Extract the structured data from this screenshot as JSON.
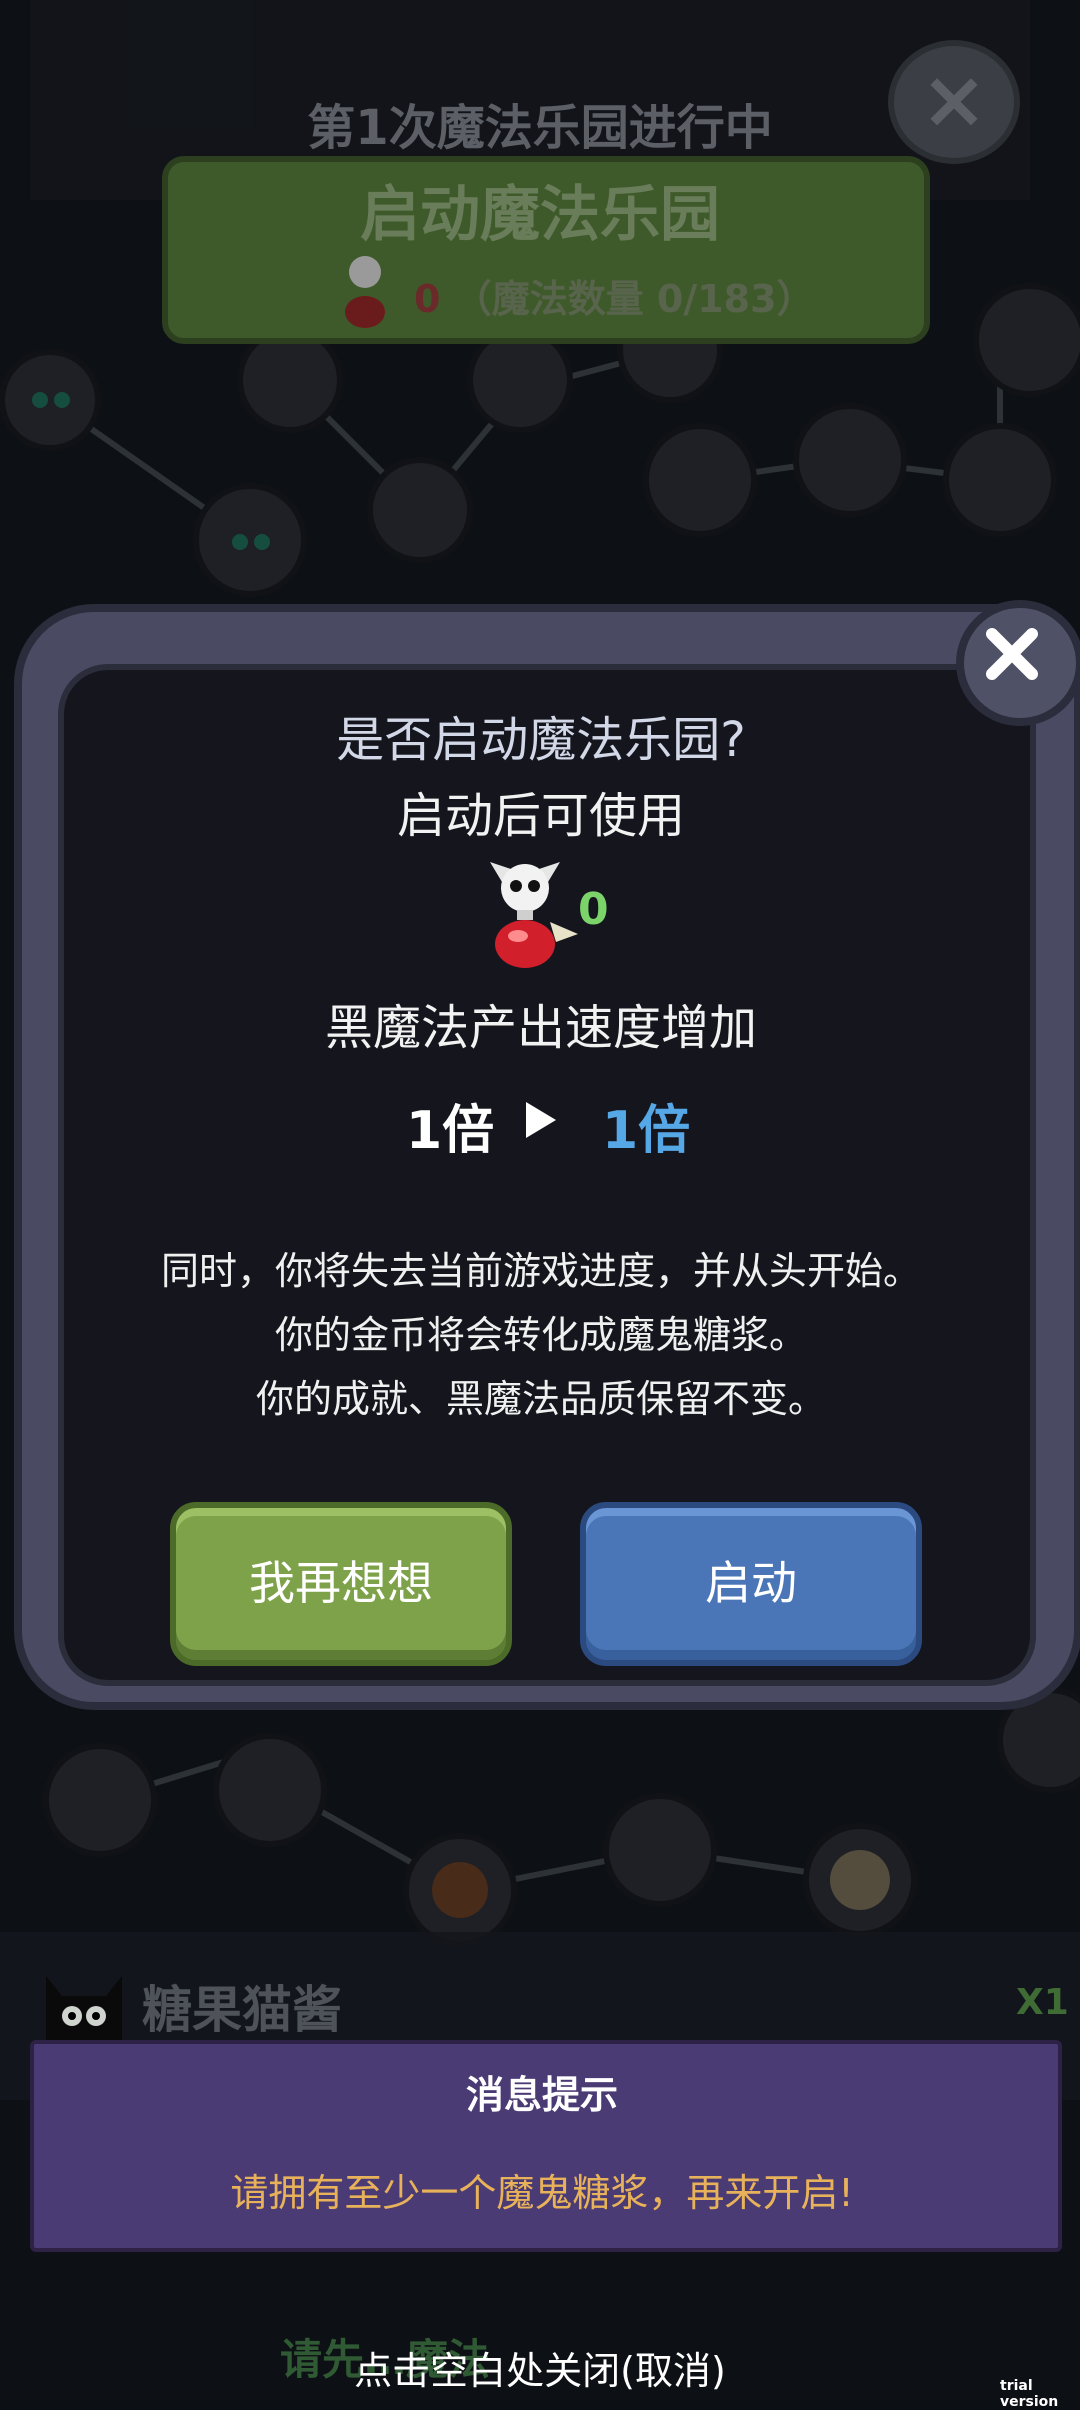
{
  "header": {
    "title": "第1次魔法乐园进行中",
    "start_banner_title": "启动魔法乐园",
    "magic_zero": "0",
    "magic_count": "（魔法数量 0/183）"
  },
  "dialog": {
    "question": "是否启动魔法乐园?",
    "subtitle": "启动后可使用",
    "potion_value": "0",
    "speed_text": "黑魔法产出速度增加",
    "multiplier_from": "1倍",
    "multiplier_to": "1倍",
    "warnings": [
      "同时，你将失去当前游戏进度，并从头开始。",
      "你的金币将会转化成魔鬼糖浆。",
      "你的成就、黑魔法品质保留不变。"
    ],
    "cancel_label": "我再想想",
    "start_label": "启动"
  },
  "bottom": {
    "cat_name": "糖果猫酱",
    "cat_multiplier": "X1",
    "message_title": "消息提示",
    "message_body": "请拥有至少一个魔鬼糖浆，再来开启!",
    "hidden_hint": "请先…魔法",
    "close_hint": "点击空白处关闭(取消)",
    "watermark": "trial version"
  },
  "colors": {
    "accent_blue": "#56a7e6",
    "button_green": "#7ea24a",
    "button_blue": "#4a76b8",
    "message_text": "#e8b25a",
    "message_bg": "#4b3b74"
  },
  "icons": [
    "close-icon",
    "skull-potion-icon",
    "play-arrow-icon",
    "cat-icon"
  ]
}
